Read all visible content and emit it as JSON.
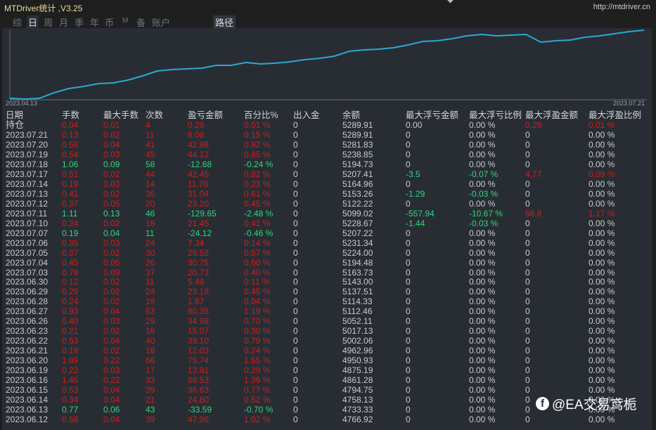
{
  "window": {
    "title": "MTDriver统计 ,V3.25",
    "url": "http://mtdriver.cn"
  },
  "tabs": [
    {
      "label": "综",
      "active": false
    },
    {
      "label": "日",
      "active": true
    },
    {
      "label": "周",
      "active": false
    },
    {
      "label": "月",
      "active": false
    },
    {
      "label": "季",
      "active": false
    },
    {
      "label": "年",
      "active": false
    },
    {
      "label": "币",
      "active": false
    },
    {
      "label": "M",
      "active": false
    },
    {
      "label": "备",
      "active": false
    },
    {
      "label": "账户",
      "active": false
    }
  ],
  "path_tab": "路径",
  "chart": {
    "type": "line",
    "x_start_label": "2023.04.13",
    "x_end_label": "2023.07.21",
    "line_color": "#2aa9d2",
    "values": [
      4204,
      4192,
      4204,
      4293,
      4360,
      4394,
      4439,
      4450,
      4495,
      4562,
      4640,
      4663,
      4674,
      4685,
      4730,
      4730,
      4775,
      4752,
      4764,
      4786,
      4820,
      4842,
      4876,
      4954,
      4976,
      4988,
      5010,
      5055,
      5111,
      5122,
      5156,
      5200,
      5223,
      5200,
      5212,
      5223,
      5099,
      5122,
      5133,
      5178,
      5200,
      5234,
      5268,
      5290
    ]
  },
  "colors": {
    "profit": "#d01c1c",
    "loss": "#2ed67a"
  },
  "table": {
    "headers": [
      "日期",
      "手数",
      "最大手数",
      "次数",
      "盈亏金额",
      "百分比%",
      "出入金",
      "余额",
      "最大浮亏金额",
      "最大浮亏比例",
      "最大浮盈金额",
      "最大浮盈比例"
    ],
    "rows": [
      [
        "持仓",
        "0.04",
        "0.01",
        "4",
        "0.29",
        "0.01 %",
        "0",
        "5289.91",
        "0.00",
        "0.00 %",
        "0.29",
        "0.01 %"
      ],
      [
        "2023.07.21",
        "0.13",
        "0.02",
        "11",
        "8.08",
        "0.15 %",
        "0",
        "5289.91",
        "0",
        "0.00 %",
        "0",
        "0.00 %"
      ],
      [
        "2023.07.20",
        "0.58",
        "0.04",
        "41",
        "42.98",
        "0.82 %",
        "0",
        "5281.83",
        "0",
        "0.00 %",
        "0",
        "0.00 %"
      ],
      [
        "2023.07.19",
        "0.54",
        "0.03",
        "45",
        "44.12",
        "0.85 %",
        "0",
        "5238.85",
        "0",
        "0.00 %",
        "0",
        "0.00 %"
      ],
      [
        "2023.07.18",
        "1.06",
        "0.09",
        "58",
        "-12.68",
        "-0.24 %",
        "0",
        "5194.73",
        "0",
        "0.00 %",
        "0",
        "0.00 %"
      ],
      [
        "2023.07.17",
        "0.51",
        "0.02",
        "44",
        "42.45",
        "0.82 %",
        "0",
        "5207.41",
        "-3.5",
        "-0.07 %",
        "4.77",
        "0.09 %"
      ],
      [
        "2023.07.14",
        "0.19",
        "0.03",
        "14",
        "11.70",
        "0.23 %",
        "0",
        "5164.96",
        "0",
        "0.00 %",
        "0",
        "0.00 %"
      ],
      [
        "2023.07.13",
        "0.41",
        "0.02",
        "36",
        "31.04",
        "0.61 %",
        "0",
        "5153.26",
        "-1.29",
        "-0.03 %",
        "0",
        "0.00 %"
      ],
      [
        "2023.07.12",
        "0.37",
        "0.05",
        "20",
        "23.20",
        "0.45 %",
        "0",
        "5122.22",
        "0",
        "0.00 %",
        "0",
        "0.00 %"
      ],
      [
        "2023.07.11",
        "1.11",
        "0.13",
        "46",
        "-129.65",
        "-2.48 %",
        "0",
        "5099.02",
        "-557.94",
        "-10.67 %",
        "58.8",
        "1.17 %"
      ],
      [
        "2023.07.10",
        "0.24",
        "0.02",
        "18",
        "21.45",
        "0.41 %",
        "0",
        "5228.67",
        "-1.44",
        "-0.03 %",
        "0",
        "0.00 %"
      ],
      [
        "2023.07.07",
        "0.19",
        "0.04",
        "11",
        "-24.12",
        "-0.46 %",
        "0",
        "5207.22",
        "0",
        "0.00 %",
        "0",
        "0.00 %"
      ],
      [
        "2023.07.06",
        "0.35",
        "0.03",
        "24",
        "7.34",
        "0.14 %",
        "0",
        "5231.34",
        "0",
        "0.00 %",
        "0",
        "0.00 %"
      ],
      [
        "2023.07.05",
        "0.37",
        "0.02",
        "30",
        "29.52",
        "0.57 %",
        "0",
        "5224.00",
        "0",
        "0.00 %",
        "0",
        "0.00 %"
      ],
      [
        "2023.07.04",
        "0.45",
        "0.05",
        "26",
        "30.75",
        "0.60 %",
        "0",
        "5194.48",
        "0",
        "0.00 %",
        "0",
        "0.00 %"
      ],
      [
        "2023.07.03",
        "0.78",
        "0.09",
        "37",
        "20.73",
        "0.40 %",
        "0",
        "5163.73",
        "0",
        "0.00 %",
        "0",
        "0.00 %"
      ],
      [
        "2023.06.30",
        "0.12",
        "0.02",
        "11",
        "5.49",
        "0.11 %",
        "0",
        "5143.00",
        "0",
        "0.00 %",
        "0",
        "0.00 %"
      ],
      [
        "2023.06.29",
        "0.29",
        "0.02",
        "24",
        "23.18",
        "0.45 %",
        "0",
        "5137.51",
        "0",
        "0.00 %",
        "0",
        "0.00 %"
      ],
      [
        "2023.06.28",
        "0.24",
        "0.02",
        "19",
        "1.87",
        "0.04 %",
        "0",
        "5114.33",
        "0",
        "0.00 %",
        "0",
        "0.00 %"
      ],
      [
        "2023.06.27",
        "0.93",
        "0.04",
        "63",
        "60.35",
        "1.19 %",
        "0",
        "5112.46",
        "0",
        "0.00 %",
        "0",
        "0.00 %"
      ],
      [
        "2023.06.26",
        "0.40",
        "0.03",
        "29",
        "34.98",
        "0.70 %",
        "0",
        "5052.11",
        "0",
        "0.00 %",
        "0",
        "0.00 %"
      ],
      [
        "2023.06.23",
        "0.21",
        "0.02",
        "16",
        "15.07",
        "0.30 %",
        "0",
        "5017.13",
        "0",
        "0.00 %",
        "0",
        "0.00 %"
      ],
      [
        "2023.06.22",
        "0.53",
        "0.04",
        "40",
        "39.10",
        "0.79 %",
        "0",
        "5002.06",
        "0",
        "0.00 %",
        "0",
        "0.00 %"
      ],
      [
        "2023.06.21",
        "0.19",
        "0.02",
        "18",
        "12.03",
        "0.24 %",
        "0",
        "4962.96",
        "0",
        "0.00 %",
        "0",
        "0.00 %"
      ],
      [
        "2023.06.20",
        "1.89",
        "0.22",
        "66",
        "75.74",
        "1.55 %",
        "0",
        "4950.93",
        "0",
        "0.00 %",
        "0",
        "0.00 %"
      ],
      [
        "2023.06.19",
        "0.22",
        "0.03",
        "17",
        "13.91",
        "0.29 %",
        "0",
        "4875.19",
        "0",
        "0.00 %",
        "0",
        "0.00 %"
      ],
      [
        "2023.06.16",
        "1.45",
        "0.22",
        "33",
        "66.53",
        "1.39 %",
        "0",
        "4861.28",
        "0",
        "0.00 %",
        "0",
        "0.00 %"
      ],
      [
        "2023.06.15",
        "0.53",
        "0.04",
        "39",
        "36.63",
        "0.77 %",
        "0",
        "4794.75",
        "0",
        "0.00 %",
        "0",
        "0.00 %"
      ],
      [
        "2023.06.14",
        "0.34",
        "0.04",
        "21",
        "24.80",
        "0.52 %",
        "0",
        "4758.13",
        "0",
        "0.00 %",
        "0",
        "0.00 %"
      ],
      [
        "2023.06.13",
        "0.77",
        "0.06",
        "43",
        "-33.59",
        "-0.70 %",
        "0",
        "4733.33",
        "0",
        "0.00 %",
        "0",
        "0.00 %"
      ],
      [
        "2023.06.12",
        "0.58",
        "0.04",
        "39",
        "47.96",
        "1.02 %",
        "0",
        "4766.92",
        "0",
        "0.00 %",
        "0",
        "0.00 %"
      ]
    ]
  },
  "watermark": "@EA交易鸢栀"
}
